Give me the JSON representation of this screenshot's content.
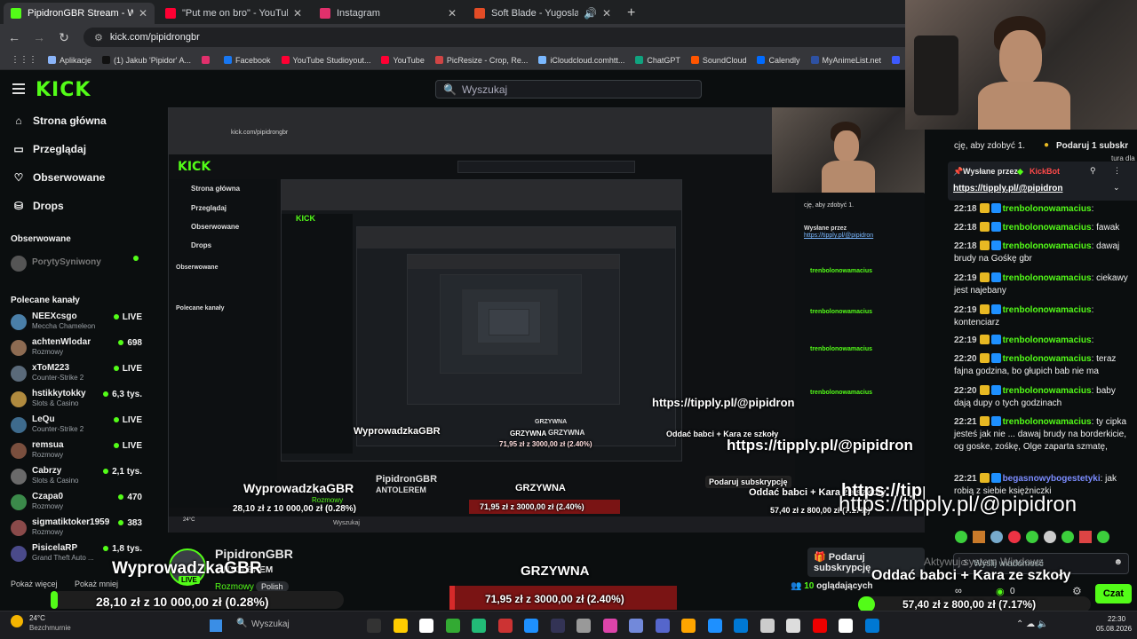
{
  "browser": {
    "tabs": [
      {
        "title": "PipidronGBR Stream - Watch Live",
        "color": "#53fc18",
        "active": true
      },
      {
        "title": "\"Put me on bro\" - YouTube",
        "color": "#ff0033",
        "active": false
      },
      {
        "title": "Instagram",
        "color": "#e1306c",
        "active": false
      },
      {
        "title": "Soft Blade - Yugoslavisky G",
        "color": "#e34c26",
        "active": false
      }
    ],
    "url": "kick.com/pipidrongbr",
    "bookmarks": [
      {
        "label": "Aplikacje",
        "color": "#8ab4f8"
      },
      {
        "label": "(1) Jakub 'Pipidor' A...",
        "color": "#111111"
      },
      {
        "label": "",
        "color": "#e1306c"
      },
      {
        "label": "Facebook",
        "color": "#1877f2"
      },
      {
        "label": "YouTube Studioyout...",
        "color": "#ff0033"
      },
      {
        "label": "YouTube",
        "color": "#ff0033"
      },
      {
        "label": "PicResize - Crop, Re...",
        "color": "#d04545"
      },
      {
        "label": "iCloudcloud.comhtt...",
        "color": "#7ab8ff"
      },
      {
        "label": "ChatGPT",
        "color": "#10a37f"
      },
      {
        "label": "SoundCloud",
        "color": "#ff5500"
      },
      {
        "label": "Calendly",
        "color": "#006bff"
      },
      {
        "label": "MyAnimeList.net",
        "color": "#2e51a2"
      },
      {
        "label": "",
        "color": "#3d5afe"
      },
      {
        "label": "Huberman Lab Full...",
        "color": "#ff0033"
      }
    ]
  },
  "kick": {
    "logo": "KICK",
    "search_placeholder": "Wyszukaj",
    "nav": [
      {
        "label": "Strona główna",
        "icon": "home-icon"
      },
      {
        "label": "Przeglądaj",
        "icon": "browse-icon"
      },
      {
        "label": "Obserwowane",
        "icon": "heart-icon"
      },
      {
        "label": "Drops",
        "icon": "drops-icon"
      }
    ],
    "followed_header": "Obserwowane",
    "followed": [
      {
        "name": "PorytySyniwony"
      }
    ],
    "recommended_header": "Polecane kanały",
    "channels": [
      {
        "name": "NEEXcsgo",
        "category": "Meccha Chameleon",
        "viewers": "LIVE",
        "color": "#4a7fa8"
      },
      {
        "name": "achtenWlodar",
        "category": "Rozmowy",
        "viewers": "698",
        "color": "#8d6b52"
      },
      {
        "name": "xToM223",
        "category": "Counter-Strike 2",
        "viewers": "LIVE",
        "color": "#5a6a7a"
      },
      {
        "name": "hstikkytokky",
        "category": "Slots & Casino",
        "viewers": "6,3 tys.",
        "color": "#b08a3e"
      },
      {
        "name": "LeQu",
        "category": "Counter-Strike 2",
        "viewers": "LIVE",
        "color": "#3e6b8d"
      },
      {
        "name": "remsua",
        "category": "Rozmowy",
        "viewers": "LIVE",
        "color": "#7a4f3e"
      },
      {
        "name": "Cabrzy",
        "category": "Slots & Casino",
        "viewers": "2,1 tys.",
        "color": "#6a6a6a"
      },
      {
        "name": "Czapa0",
        "category": "Rozmowy",
        "viewers": "470",
        "color": "#3b8a4a"
      },
      {
        "name": "sigmatiktoker1959",
        "category": "Rozmowy",
        "viewers": "383",
        "color": "#8a4a4a"
      },
      {
        "name": "PisicelaRP",
        "category": "Grand Theft Auto ...",
        "viewers": "1,8 tys.",
        "color": "#4a4a8a"
      }
    ],
    "show_more": "Pokaż więcej",
    "show_less": "Pokaż mniej"
  },
  "stream": {
    "streamer": "PipidronGBR",
    "subtitle": "ANTOLEREM",
    "category": "Rozmowy",
    "language": "Polish",
    "viewers_count": "10",
    "viewers_label": "oglądających",
    "subscribe_label": "Podaruj subskrypcję",
    "live_badge": "LIVE"
  },
  "overlays": {
    "goal1_title": "WyprowadzkaGBR",
    "goal1_amount": "28,10 zł z 10 000,00 zł (0.28%)",
    "goal1_fraction": 0.0028,
    "goal2_title": "GRZYWNA",
    "goal2_amount": "71,95 zł z 3000,00 zł (2.40%)",
    "goal2_fraction": 0.024,
    "goal3_title": "Oddać babci + Kara ze szkoły",
    "goal3_amount": "57,40 zł z 800,00 zł (7.17%)",
    "goal3_fraction": 0.0717,
    "tipply": "https://tipply.pl/@pipidron",
    "system": "Aktywuj system Windows"
  },
  "chat": {
    "top_text": "cję, aby zdobyć 1.",
    "top_gift": "Podaruj 1 subskr",
    "top_extra": "tura dla",
    "pinned_by_label": "Wysłane przez",
    "pinned_user": "KickBot",
    "pinned_link": "https://tipply.pl/@pipidron",
    "messages": [
      {
        "time": "22:18",
        "user": "trenbolonowamacius",
        "text": ":",
        "color": "#53fc18"
      },
      {
        "time": "22:18",
        "user": "trenbolonowamacius",
        "text": ": fawak",
        "color": "#53fc18"
      },
      {
        "time": "22:18",
        "user": "trenbolonowamacius",
        "text": ": dawaj brudy na Gośkę gbr",
        "color": "#53fc18"
      },
      {
        "time": "22:19",
        "user": "trenbolonowamacius",
        "text": ": ciekawy jest najebany",
        "color": "#53fc18"
      },
      {
        "time": "22:19",
        "user": "trenbolonowamacius",
        "text": ": kontenciarz",
        "color": "#53fc18"
      },
      {
        "time": "22:19",
        "user": "trenbolonowamacius",
        "text": ":",
        "color": "#53fc18"
      },
      {
        "time": "22:20",
        "user": "trenbolonowamacius",
        "text": ": teraz fajna godzina, bo głupich bab nie ma",
        "color": "#53fc18"
      },
      {
        "time": "22:20",
        "user": "trenbolonowamacius",
        "text": ": baby dają dupy o tych godzinach",
        "color": "#53fc18"
      },
      {
        "time": "22:21",
        "user": "trenbolonowamacius",
        "text": ": ty cipka jesteś jak nie ... dawaj brudy na borderkicie, og goske, zośkę, Olge zaparta szmatę,",
        "color": "#53fc18"
      },
      {
        "time": "22:21",
        "user": "begasnowybogestetyki",
        "text": ": jak robią z siebie księżniczki",
        "color": "#7b8cff"
      }
    ],
    "input_placeholder": "Wyślij wiadomość",
    "count": "0",
    "send_label": "Czat"
  },
  "taskbar": {
    "weather_temp": "24°C",
    "weather_desc": "Bezchmurnie",
    "search_placeholder": "Wyszukaj",
    "time": "22:30",
    "date": "05.08.2026"
  }
}
